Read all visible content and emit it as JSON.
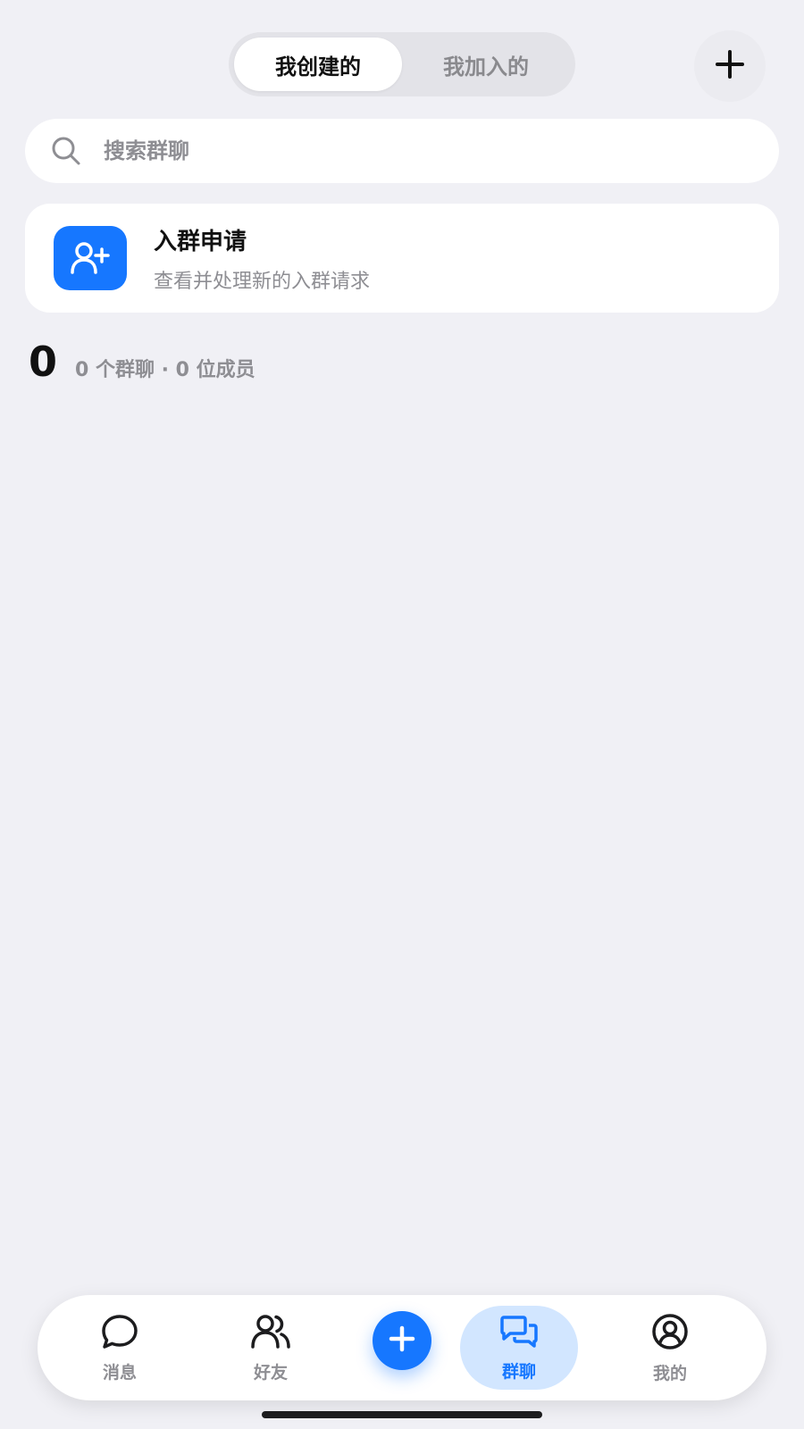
{
  "tabs": {
    "created_label": "我创建的",
    "joined_label": "我加入的"
  },
  "search": {
    "placeholder": "搜索群聊"
  },
  "join_request": {
    "title": "入群申请",
    "subtitle": "查看并处理新的入群请求"
  },
  "summary": {
    "count": "0",
    "text": "0 个群聊 · 0 位成员"
  },
  "tabbar": {
    "messages_label": "消息",
    "friends_label": "好友",
    "groups_label": "群聊",
    "me_label": "我的"
  },
  "colors": {
    "accent": "#1677ff",
    "background": "#f0f0f5",
    "active_pill": "#d2e6ff"
  },
  "icons": {
    "add": "plus-icon",
    "search": "search-icon",
    "join_request": "user-add-icon",
    "messages": "chat-bubble-icon",
    "friends": "users-icon",
    "fab": "plus-icon",
    "groups": "group-chat-icon",
    "me": "user-circle-icon"
  }
}
